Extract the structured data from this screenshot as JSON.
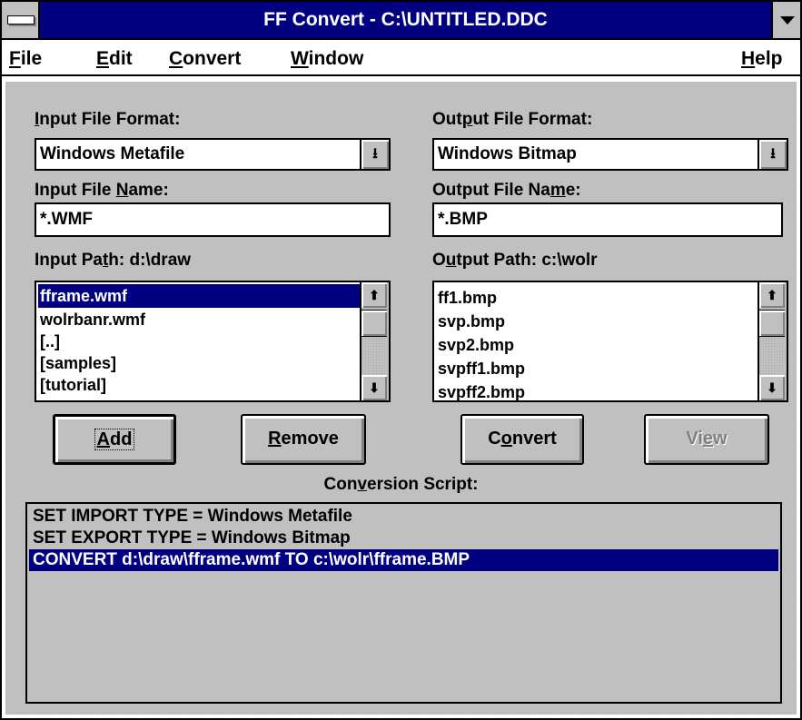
{
  "window": {
    "title": "FF Convert - C:\\UNTITLED.DDC"
  },
  "menu": {
    "file": {
      "pre": "",
      "acc": "F",
      "post": "ile"
    },
    "edit": {
      "pre": "",
      "acc": "E",
      "post": "dit"
    },
    "convert": {
      "pre": "",
      "acc": "C",
      "post": "onvert"
    },
    "window": {
      "pre": "",
      "acc": "W",
      "post": "indow"
    },
    "help": {
      "pre": "",
      "acc": "H",
      "post": "elp"
    }
  },
  "input": {
    "format_label": {
      "pre": "",
      "acc": "I",
      "post": "nput File Format:"
    },
    "format_value": "Windows Metafile",
    "name_label": {
      "pre": "Input File ",
      "acc": "N",
      "post": "ame:"
    },
    "name_value": "*.WMF",
    "path_label": {
      "pre": "Input Pa",
      "acc": "t",
      "post": "h:  d:\\draw"
    },
    "files": [
      "fframe.wmf",
      "wolrbanr.wmf",
      "[..]",
      "[samples]",
      "[tutorial]"
    ],
    "selected_index": 0
  },
  "output": {
    "format_label": {
      "pre": "Out",
      "acc": "p",
      "post": "ut File Format:"
    },
    "format_value": "Windows Bitmap",
    "name_label": {
      "pre": "Output File Na",
      "acc": "m",
      "post": "e:"
    },
    "name_value": "*.BMP",
    "path_label": {
      "pre": "O",
      "acc": "u",
      "post": "tput Path:  c:\\wolr"
    },
    "files": [
      "ff1.bmp",
      "svp.bmp",
      "svp2.bmp",
      "svpff1.bmp",
      "svpff2.bmp"
    ]
  },
  "buttons": {
    "add": {
      "pre": "",
      "acc": "A",
      "post": "dd"
    },
    "remove": {
      "pre": "",
      "acc": "R",
      "post": "emove"
    },
    "convert": {
      "pre": "C",
      "acc": "o",
      "post": "nvert"
    },
    "view": {
      "pre": "Vi",
      "acc": "e",
      "post": "w"
    }
  },
  "script": {
    "label": {
      "pre": "Con",
      "acc": "v",
      "post": "ersion Script:"
    },
    "lines": [
      "SET IMPORT TYPE = Windows Metafile",
      "SET EXPORT TYPE = Windows Bitmap",
      "CONVERT d:\\draw\\fframe.wmf TO c:\\wolr\\fframe.BMP"
    ],
    "selected_index": 2
  },
  "icons": {
    "system_menu": "system-menu-icon",
    "minimize": "minimize-arrow-icon",
    "dropdown": "dropdown-arrow-icon",
    "scroll_up": "scroll-up-arrow-icon",
    "scroll_down": "scroll-down-arrow-icon"
  },
  "colors": {
    "titlebar": "#000080",
    "selection": "#000080",
    "face": "#c0c0c0"
  }
}
